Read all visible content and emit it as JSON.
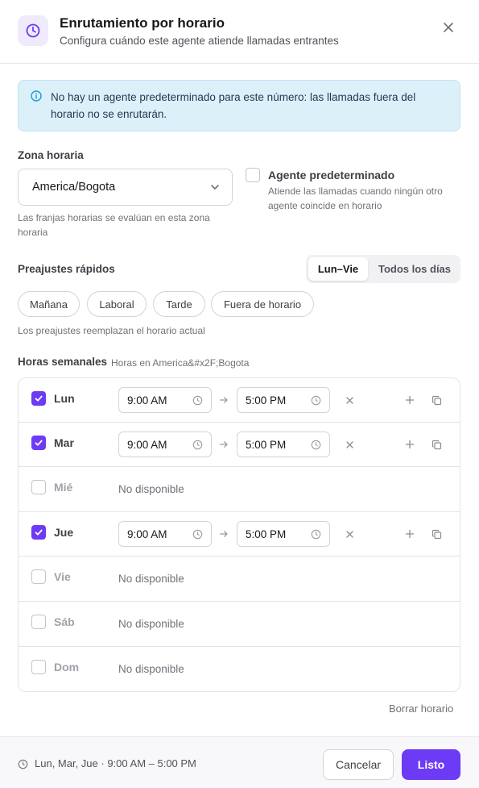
{
  "header": {
    "title": "Enrutamiento por horario",
    "subtitle": "Configura cuándo este agente atiende llamadas entrantes",
    "icon": "clock-icon",
    "close_icon": "close-icon"
  },
  "info": {
    "text": "No hay un agente predeterminado para este número: las llamadas fuera del horario no se enrutarán.",
    "icon": "info-icon"
  },
  "timezone": {
    "label": "Zona horaria",
    "value": "America/Bogota",
    "help": "Las franjas horarias se evalúan en esta zona horaria"
  },
  "default_agent": {
    "checked": false,
    "title": "Agente predeterminado",
    "description": "Atiende las llamadas cuando ningún otro agente coincide en horario"
  },
  "presets": {
    "label": "Preajustes rápidos",
    "segments": [
      "Lun–Vie",
      "Todos los días"
    ],
    "active_segment": "Lun–Vie",
    "buttons": [
      "Mañana",
      "Laboral",
      "Tarde",
      "Fuera de horario"
    ],
    "help": "Los preajustes reemplazan el horario actual"
  },
  "weekly": {
    "title": "Horas semanales",
    "subtitle": "Horas en America&#x2F;Bogota",
    "unavailable_text": "No disponible",
    "days": [
      {
        "name": "Lun",
        "enabled": true,
        "start": "9:00 AM",
        "end": "5:00 PM"
      },
      {
        "name": "Mar",
        "enabled": true,
        "start": "9:00 AM",
        "end": "5:00 PM"
      },
      {
        "name": "Mié",
        "enabled": false,
        "text": "No disponible"
      },
      {
        "name": "Jue",
        "enabled": true,
        "start": "9:00 AM",
        "end": "5:00 PM"
      },
      {
        "name": "Vie",
        "enabled": false,
        "text": "No disponible"
      },
      {
        "name": "Sáb",
        "enabled": false,
        "text": "No disponible"
      },
      {
        "name": "Dom",
        "enabled": false,
        "text": "No disponible"
      }
    ],
    "clear_label": "Borrar horario"
  },
  "footer": {
    "summary": "Lun, Mar, Jue · 9:00 AM – 5:00 PM",
    "cancel_label": "Cancelar",
    "done_label": "Listo"
  },
  "colors": {
    "accent": "#6d3bf5",
    "info_bg": "#dcf0fa",
    "info_icon": "#1a9bd6"
  }
}
